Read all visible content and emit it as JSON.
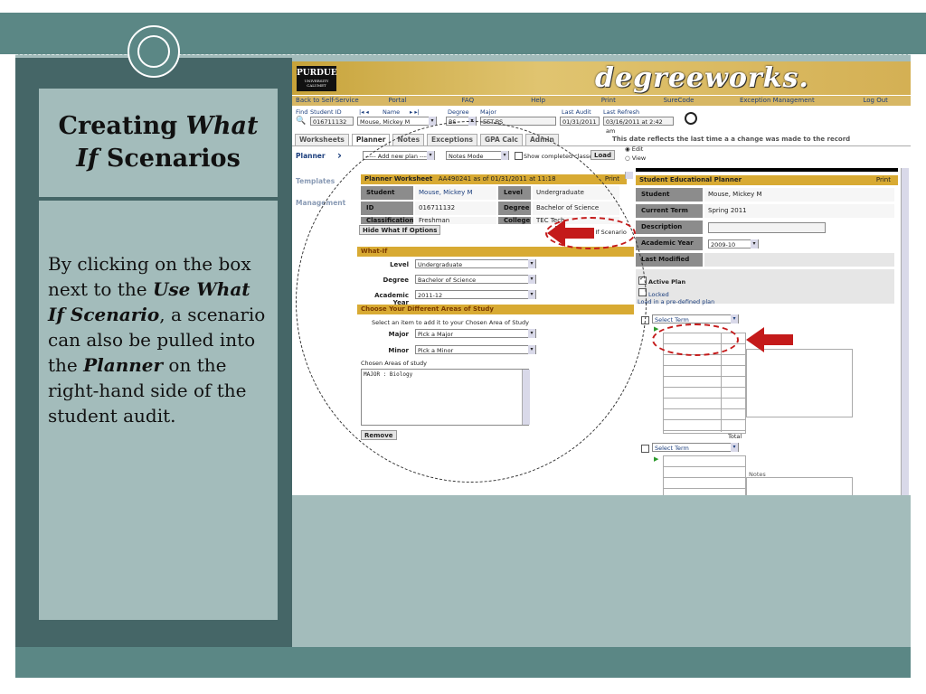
{
  "slide": {
    "title_part1": "Creating ",
    "title_em1": "What",
    "title_em2": "If",
    "title_part2": " Scenarios",
    "body_1": "By clicking on the box next to the ",
    "body_em1": "Use What If Scenario",
    "body_2": ", a scenario can also be pulled into the ",
    "body_em2": "Planner",
    "body_3": " on the right-hand side of the student audit."
  },
  "colors": {
    "slide_dark": "#456667",
    "slide_mid": "#5b8785",
    "slide_light": "#a3bcbb",
    "gold": "#d8aa33",
    "oval_red": "#c41a1a"
  },
  "app": {
    "purdue_logo": "PURDUE",
    "purdue_sub1": "UNIVERSITY",
    "purdue_sub2": "CALUMET",
    "brand": "degreeworks.",
    "nav": [
      "Back to Self-Service",
      "Portal",
      "FAQ",
      "Help",
      "Print",
      "SureCode",
      "Exception Management",
      "Log Out"
    ],
    "find": {
      "find_label": "Find",
      "student_id_label": "Student ID",
      "student_id": "016711132",
      "name_label": "Name",
      "name": "Mouse, Mickey M",
      "degree_label": "Degree",
      "degree": "BS",
      "major_label": "Major",
      "major": "EET-BS",
      "last_audit_label": "Last Audit",
      "last_audit": "01/31/2011",
      "last_refresh_label": "Last Refresh",
      "last_refresh": "03/16/2011 at 2:42 am"
    },
    "tabs": [
      "Worksheets",
      "Planner",
      "Notes",
      "Exceptions",
      "GPA Calc",
      "Admin"
    ],
    "tab_note": "This date reflects the last time a a change was made to the record",
    "side_nav": [
      "Planner",
      "Templates",
      "Management"
    ],
    "planner_controls": {
      "plan_select": "----- Add new plan -----",
      "mode_select": "Notes Mode",
      "show_completed": "Show completed classes",
      "load_button": "Load",
      "edit_label": "Edit",
      "view_label": "View"
    },
    "worksheet": {
      "header": "Planner Worksheet",
      "header_meta": "AA490241 as of 01/31/2011 at 11:18",
      "print": "Print",
      "rows": [
        {
          "label": "Student",
          "value": "Mouse, Mickey M",
          "label2": "Level",
          "value2": "Undergraduate"
        },
        {
          "label": "ID",
          "value": "016711132",
          "label2": "Degree",
          "value2": "Bachelor of Science"
        },
        {
          "label": "Classification",
          "value": "Freshman",
          "label2": "College",
          "value2": "TEC Tech"
        }
      ]
    },
    "whatif": {
      "hide_button": "Hide What If Options",
      "use_checkbox": "Use What If Scenario",
      "section_title": "What-If",
      "level_label": "Level",
      "level": "Undergraduate",
      "degree_label": "Degree",
      "degree": "Bachelor of Science",
      "year_label": "Academic Year",
      "year": "2011-12",
      "areas_title": "Choose Your Different Areas of Study",
      "areas_hint": "Select an item to add it to your Chosen Area of Study",
      "major_label": "Major",
      "major": "Pick a Major",
      "minor_label": "Minor",
      "minor": "Pick a Minor",
      "chosen_label": "Chosen Areas of study",
      "chosen_text": "MAJOR : Biology",
      "remove_button": "Remove"
    },
    "edu_planner": {
      "header": "Student Educational Planner",
      "print": "Print",
      "student_label": "Student",
      "student": "Mouse, Mickey M",
      "term_label": "Current Term",
      "term": "Spring 2011",
      "desc_label": "Description",
      "year_label": "Academic Year",
      "year": "2009-10",
      "modified_label": "Last Modified",
      "active_plan": "Active Plan",
      "locked": "Locked",
      "load_predefined": "Load in a pre-defined plan",
      "select_term": "Select Term",
      "total": "Total",
      "notes": "Notes"
    }
  }
}
